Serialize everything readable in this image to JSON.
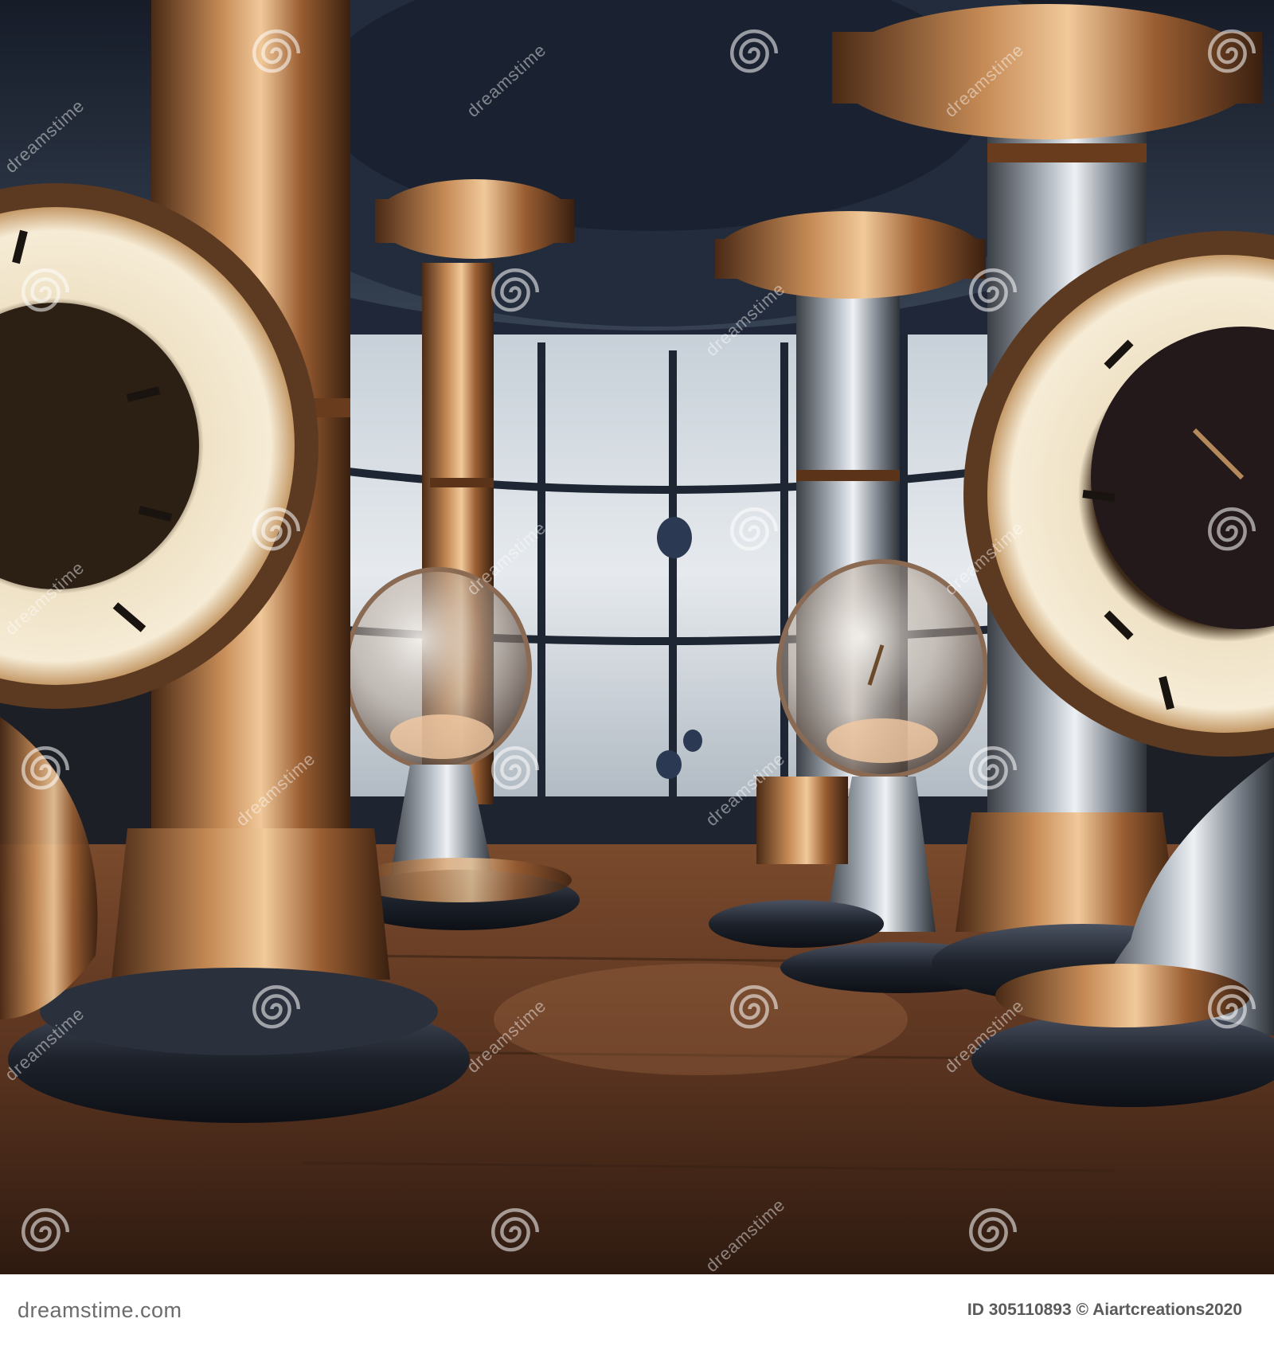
{
  "image": {
    "subject": "",
    "palette": {
      "copper": "#a76a3b",
      "copper_light": "#d8a370",
      "steel": "#9aa3ad",
      "dark_navy": "#1c2433",
      "floor": "#5a3621",
      "window": "#cfd8e0",
      "dial": "#efe2c6"
    }
  },
  "watermark": {
    "text": "dreamstime",
    "icon": "spiral-icon"
  },
  "footer": {
    "brand": "dreamstime.com",
    "id_label": "ID 305110893",
    "separator": "©",
    "author": "Aiartcreations2020"
  }
}
